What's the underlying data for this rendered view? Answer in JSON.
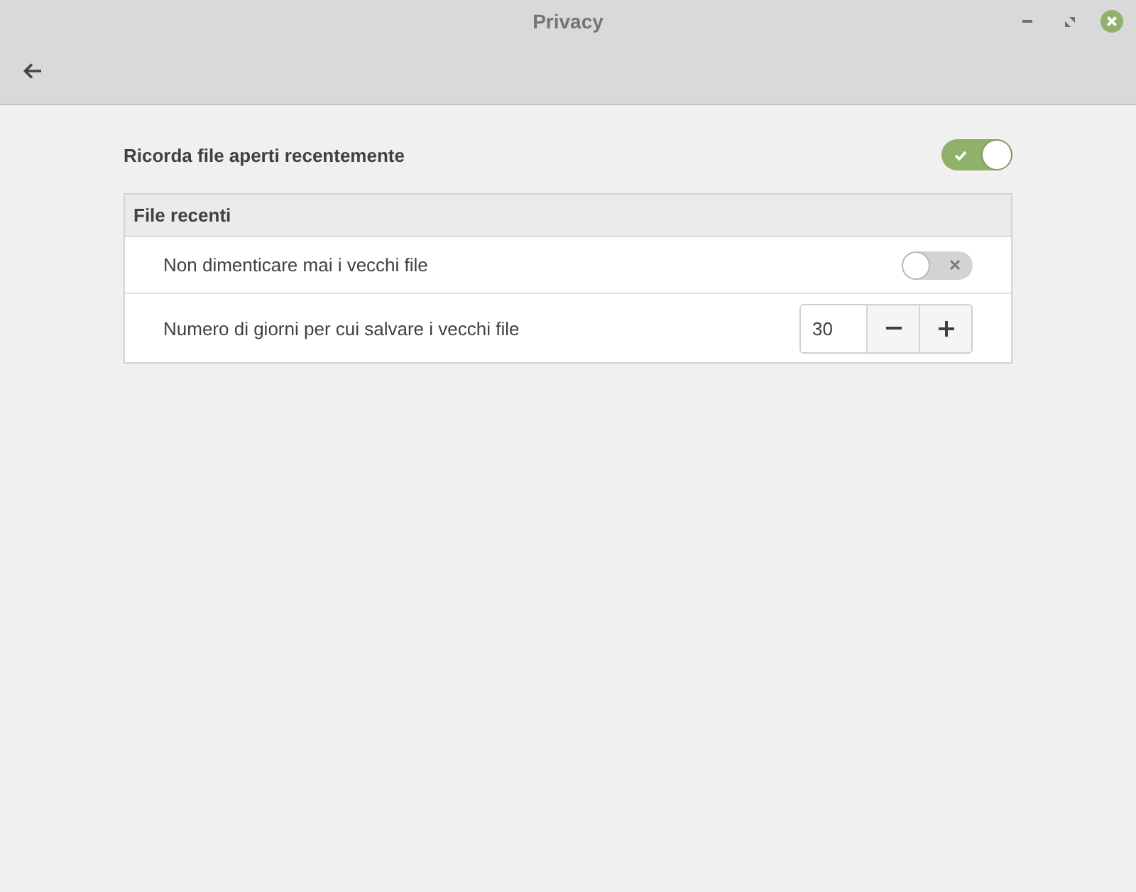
{
  "window": {
    "title": "Privacy"
  },
  "main_setting": {
    "label": "Ricorda file aperti recentemente",
    "on": true
  },
  "section": {
    "title": "File recenti",
    "rows": [
      {
        "kind": "switch",
        "label": "Non dimenticare mai i vecchi file",
        "on": false
      },
      {
        "kind": "spin",
        "label": "Numero di giorni per cui salvare i vecchi file",
        "value": "30"
      }
    ]
  }
}
